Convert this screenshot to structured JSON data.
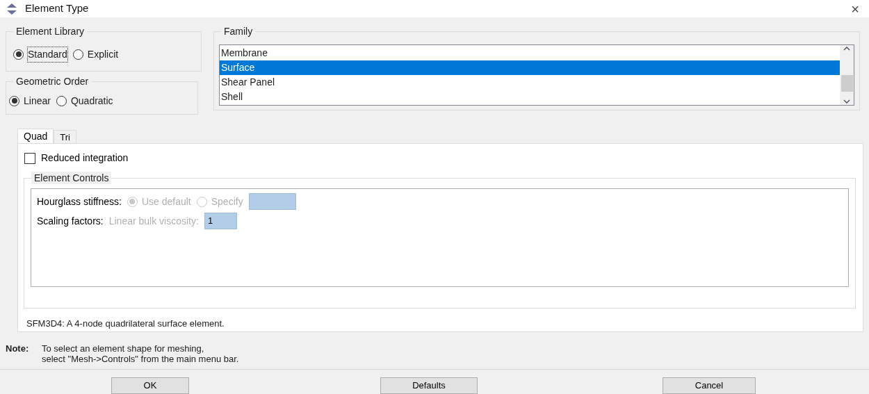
{
  "window": {
    "title": "Element Type",
    "close": "×"
  },
  "element_library": {
    "title": "Element Library",
    "options": [
      {
        "label": "Standard",
        "selected": true,
        "focused": true
      },
      {
        "label": "Explicit",
        "selected": false,
        "focused": false
      }
    ]
  },
  "geometric_order": {
    "title": "Geometric Order",
    "options": [
      {
        "label": "Linear",
        "selected": true
      },
      {
        "label": "Quadratic",
        "selected": false
      }
    ]
  },
  "family": {
    "title": "Family",
    "items": [
      {
        "label": "Membrane",
        "selected": false
      },
      {
        "label": "Surface",
        "selected": true
      },
      {
        "label": "Shear Panel",
        "selected": false
      },
      {
        "label": "Shell",
        "selected": false
      }
    ]
  },
  "tabs": [
    {
      "label": "Quad",
      "selected": true
    },
    {
      "label": "Tri",
      "selected": false
    }
  ],
  "reduced_integration": {
    "label": "Reduced integration",
    "checked": false
  },
  "element_controls": {
    "title": "Element Controls",
    "hourglass_stiffness": {
      "label": "Hourglass stiffness:",
      "disabled": true,
      "options": [
        {
          "label": "Use default",
          "selected": true
        },
        {
          "label": "Specify",
          "selected": false
        }
      ]
    },
    "scaling_factors": {
      "label": "Scaling factors:",
      "disabled": true,
      "field_label": "Linear bulk viscosity:",
      "value": "1"
    }
  },
  "description": "SFM3D4:  A 4-node quadrilateral surface element.",
  "note": {
    "label": "Note:",
    "lines": [
      "To select an element shape for meshing,",
      "select \"Mesh->Controls\" from the main menu bar."
    ]
  },
  "buttons": [
    "OK",
    "Defaults",
    "Cancel"
  ]
}
